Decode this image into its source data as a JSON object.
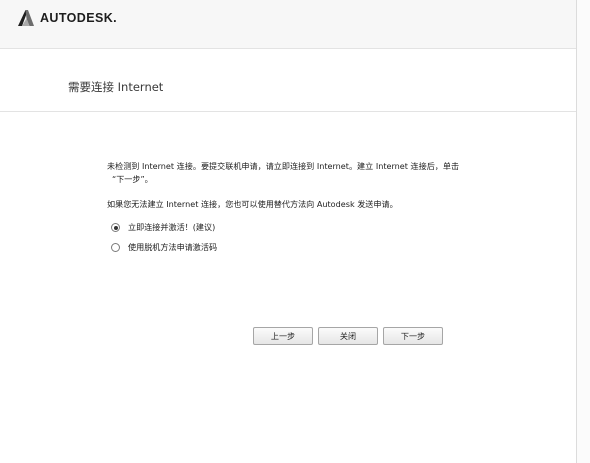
{
  "header": {
    "brand": "AUTODESK."
  },
  "page": {
    "title": "需要连接 Internet"
  },
  "content": {
    "message_line1": "未检测到 Internet 连接。要提交联机申请，请立即连接到 Internet。建立 Internet 连接后，单击",
    "message_line2": "“下一步”。",
    "message_alt": "如果您无法建立 Internet 连接，您也可以使用替代方法向 Autodesk 发送申请。"
  },
  "options": [
    {
      "label": "立即连接并激活！(建议)",
      "selected": true
    },
    {
      "label": "使用脱机方法申请激活码",
      "selected": false
    }
  ],
  "buttons": {
    "back": "上一步",
    "close": "关闭",
    "next": "下一步"
  },
  "colors": {
    "logo_primary": "#1f1f1f",
    "logo_shade": "#6d6d6d",
    "header_bg": "#f7f7f7"
  }
}
